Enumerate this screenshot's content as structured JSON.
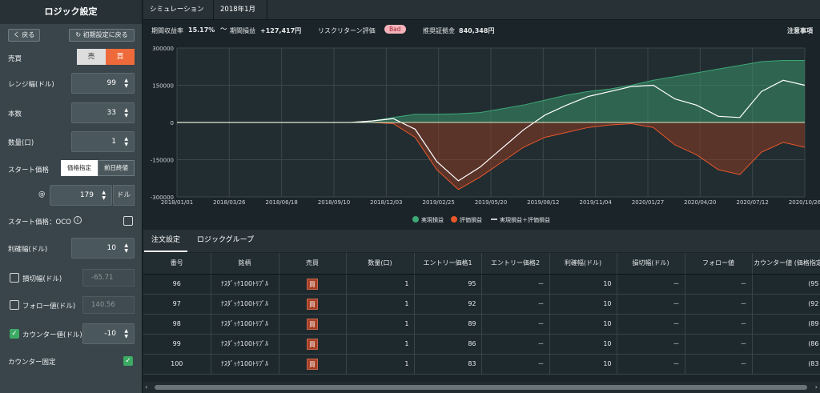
{
  "sidebar": {
    "title": "ロジック設定",
    "back": "く 戻る",
    "reset": "↻ 初期設定に戻る",
    "side_label": "売買",
    "sell": "売",
    "buy": "買",
    "range_label": "レンジ幅(ドル)",
    "range_value": "99",
    "count_label": "本数",
    "count_value": "33",
    "qty_label": "数量(口)",
    "qty_value": "1",
    "start_label": "スタート価格",
    "price_spec": "価格指定",
    "prev_close": "前日終値",
    "at": "@",
    "price_value": "179",
    "dollar": "ドル",
    "oco_label": "スタート価格：OCO",
    "info": "i",
    "takeprofit_label": "利確幅(ドル)",
    "takeprofit_value": "10",
    "stoploss_label": "損切幅(ドル)",
    "stoploss_value": "-65.71",
    "follow_label": "フォロー値(ドル)",
    "follow_value": "140.56",
    "counter_label": "カウンター値(ドル)",
    "counter_value": "-10",
    "counter_fixed_label": "カウンター固定",
    "check": "✓"
  },
  "tabs": {
    "sim": "シミュレーション",
    "period": "2018年1月～"
  },
  "stats": {
    "ret_label": "期間収益率",
    "ret_value": "15.17%",
    "pnl_label": "期間損益",
    "pnl_value": "+127,417円",
    "risk_label": "リスクリターン評価",
    "risk_badge": "Bad",
    "margin_label": "推奨証拠金",
    "margin_value": "840,348円",
    "notes": "注意事項"
  },
  "chart_data": {
    "type": "area",
    "y_ticks": [
      "300000",
      "150000",
      "0",
      "-150000",
      "-300000"
    ],
    "ylim": [
      -300000,
      300000
    ],
    "x_ticks": [
      "2018/01/01",
      "2018/03/26",
      "2018/06/18",
      "2018/09/10",
      "2018/12/03",
      "2019/02/25",
      "2019/05/20",
      "2019/08/12",
      "2019/11/04",
      "2020/01/27",
      "2020/04/20",
      "2020/07/12",
      "2020/10/26"
    ],
    "series": [
      {
        "name": "実現損益",
        "color": "#3ea876",
        "values": [
          0,
          0,
          0,
          0,
          0,
          0,
          0,
          0,
          0,
          6000,
          20000,
          33000,
          33000,
          35000,
          40000,
          55000,
          70000,
          90000,
          110000,
          125000,
          135000,
          150000,
          170000,
          185000,
          200000,
          215000,
          230000,
          245000,
          250000,
          250000
        ]
      },
      {
        "name": "評価損益",
        "color": "#e8582b",
        "values": [
          0,
          0,
          0,
          0,
          0,
          0,
          0,
          0,
          0,
          0,
          -5000,
          -60000,
          -190000,
          -270000,
          -220000,
          -160000,
          -100000,
          -60000,
          -40000,
          -20000,
          -10000,
          -5000,
          -20000,
          -90000,
          -130000,
          -190000,
          -210000,
          -120000,
          -80000,
          -100000
        ]
      },
      {
        "name": "実現損益＋評価損益",
        "color": "#ffffff",
        "values": [
          0,
          0,
          0,
          0,
          0,
          0,
          0,
          0,
          0,
          6000,
          15000,
          -27000,
          -157000,
          -235000,
          -180000,
          -105000,
          -30000,
          30000,
          70000,
          105000,
          125000,
          145000,
          150000,
          95000,
          70000,
          25000,
          20000,
          125000,
          170000,
          150000
        ]
      }
    ]
  },
  "lower_tabs": {
    "orders": "注文設定",
    "groups": "ロジックグループ"
  },
  "table": {
    "headers": [
      "番号",
      "銘柄",
      "売買",
      "数量(口)",
      "エントリー価格1",
      "エントリー価格2",
      "利確幅(ドル)",
      "損切幅(ドル)",
      "フォロー値",
      "カウンター値 (価格指定"
    ],
    "rows": [
      [
        "96",
        "ﾅｽﾀﾞｯｸ100ﾄﾘﾌﾟﾙ",
        "買",
        "1",
        "95",
        "－",
        "10",
        "－",
        "－",
        "(95"
      ],
      [
        "97",
        "ﾅｽﾀﾞｯｸ100ﾄﾘﾌﾟﾙ",
        "買",
        "1",
        "92",
        "－",
        "10",
        "－",
        "－",
        "(92"
      ],
      [
        "98",
        "ﾅｽﾀﾞｯｸ100ﾄﾘﾌﾟﾙ",
        "買",
        "1",
        "89",
        "－",
        "10",
        "－",
        "－",
        "(89"
      ],
      [
        "99",
        "ﾅｽﾀﾞｯｸ100ﾄﾘﾌﾟﾙ",
        "買",
        "1",
        "86",
        "－",
        "10",
        "－",
        "－",
        "(86"
      ],
      [
        "100",
        "ﾅｽﾀﾞｯｸ100ﾄﾘﾌﾟﾙ",
        "買",
        "1",
        "83",
        "－",
        "10",
        "－",
        "－",
        "(83"
      ]
    ]
  }
}
